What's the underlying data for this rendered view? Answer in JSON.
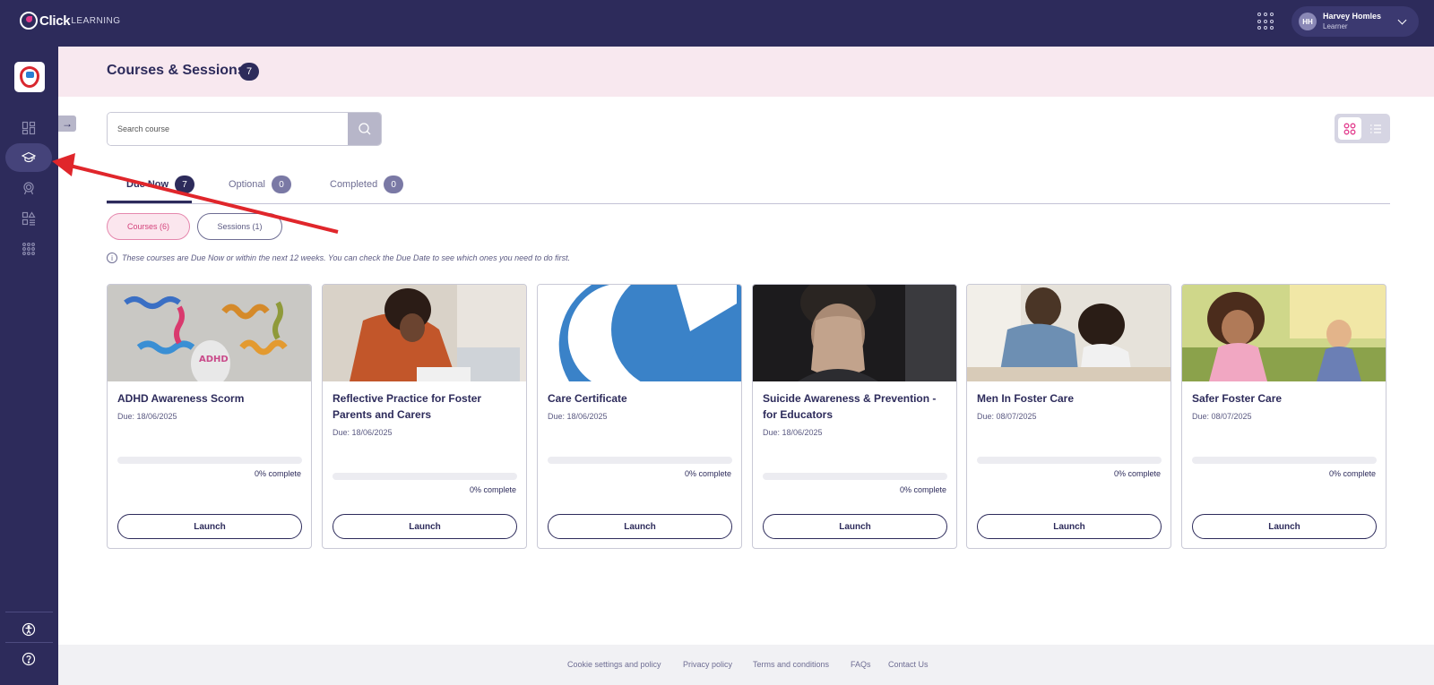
{
  "topbar": {
    "logo_word": "Click",
    "logo_sub": "LEARNING",
    "apps_icon": "apps-grid-icon",
    "user": {
      "initials": "HH",
      "name": "Harvey Homles",
      "role": "Learner"
    }
  },
  "sidebar": {
    "items": [
      {
        "name": "dashboard",
        "icon": "dashboard-icon"
      },
      {
        "name": "courses",
        "icon": "graduation-cap-icon",
        "active": true
      },
      {
        "name": "achievements",
        "icon": "award-icon"
      },
      {
        "name": "catalogue",
        "icon": "catalogue-icon"
      },
      {
        "name": "more-apps",
        "icon": "apps-grid-icon"
      }
    ],
    "bottom": [
      {
        "name": "accessibility",
        "icon": "accessibility-icon"
      },
      {
        "name": "help",
        "icon": "help-icon"
      }
    ]
  },
  "header": {
    "title": "Courses & Sessions",
    "count": "7"
  },
  "search": {
    "placeholder": "Search course"
  },
  "tabs": [
    {
      "label": "Due Now",
      "count": "7"
    },
    {
      "label": "Optional",
      "count": "0"
    },
    {
      "label": "Completed",
      "count": "0"
    }
  ],
  "filters": {
    "courses": "Courses (6)",
    "sessions": "Sessions (1)"
  },
  "info_text": "These courses are Due Now or within the next 12 weeks. You can check the Due Date to see which ones you need to do first.",
  "cards": [
    {
      "title": "ADHD Awareness Scorm",
      "due": "Due: 18/06/2025",
      "progress_text": "0% complete",
      "progress": 0,
      "button": "Launch"
    },
    {
      "title": "Reflective Practice for Foster Parents and Carers",
      "due": "Due: 18/06/2025",
      "progress_text": "0% complete",
      "progress": 0,
      "button": "Launch"
    },
    {
      "title": "Care Certificate",
      "due": "Due: 18/06/2025",
      "progress_text": "0% complete",
      "progress": 0,
      "button": "Launch"
    },
    {
      "title": "Suicide Awareness & Prevention - for Educators",
      "due": "Due: 18/06/2025",
      "progress_text": "0% complete",
      "progress": 0,
      "button": "Launch"
    },
    {
      "title": "Men In Foster Care",
      "due": "Due: 08/07/2025",
      "progress_text": "0% complete",
      "progress": 0,
      "button": "Launch"
    },
    {
      "title": "Safer Foster Care",
      "due": "Due: 08/07/2025",
      "progress_text": "0% complete",
      "progress": 0,
      "button": "Launch"
    }
  ],
  "footer": {
    "links": [
      "Cookie settings and policy",
      "Privacy policy",
      "Terms and conditions",
      "FAQs",
      "Contact Us"
    ]
  },
  "colors": {
    "brand": "#2d2b5b",
    "accent_pink": "#e23a8c",
    "header_band": "#f8e8ef",
    "annotation": "#e0262b"
  }
}
